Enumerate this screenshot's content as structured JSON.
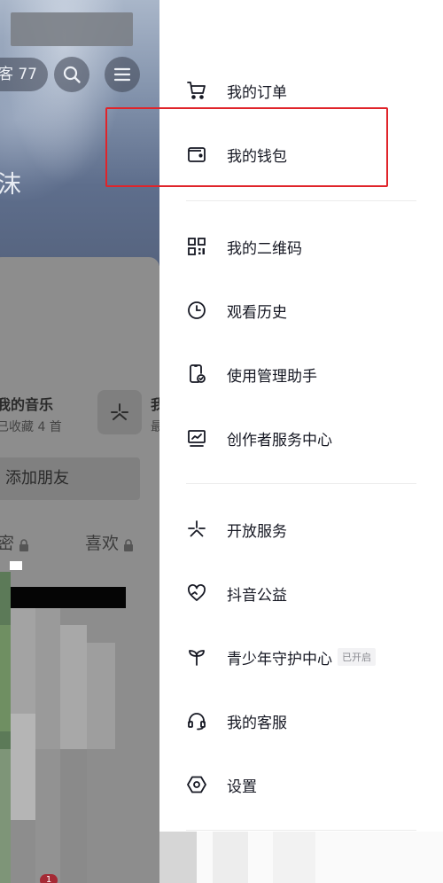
{
  "background_profile": {
    "visitor_fragment": "客 77",
    "name_fragment": "沫",
    "music": {
      "title": "我的音乐",
      "subtitle": "已收藏 4 首"
    },
    "tile_fragment_1": "我",
    "tile_fragment_2": "最",
    "add_friend_label": "添加朋友",
    "tabs": {
      "private": "密",
      "likes": "喜欢"
    },
    "badge": "1"
  },
  "drawer": {
    "groups": [
      [
        {
          "label": "我的订单",
          "icon": "cart-icon"
        },
        {
          "label": "我的钱包",
          "icon": "wallet-icon"
        }
      ],
      [
        {
          "label": "我的二维码",
          "icon": "qr-code-icon"
        },
        {
          "label": "观看历史",
          "icon": "clock-icon"
        },
        {
          "label": "使用管理助手",
          "icon": "phone-check-icon"
        },
        {
          "label": "创作者服务中心",
          "icon": "chart-monitor-icon"
        }
      ],
      [
        {
          "label": "开放服务",
          "icon": "asterisk-icon"
        },
        {
          "label": "抖音公益",
          "icon": "heart-hands-icon"
        },
        {
          "label": "青少年守护中心",
          "icon": "sprout-icon",
          "badge": "已开启"
        },
        {
          "label": "我的客服",
          "icon": "headset-icon"
        },
        {
          "label": "设置",
          "icon": "settings-hexagon-icon"
        }
      ]
    ]
  },
  "colors": {
    "highlight_border": "#e0242a",
    "menu_text": "#161823",
    "divider": "#ececec"
  }
}
